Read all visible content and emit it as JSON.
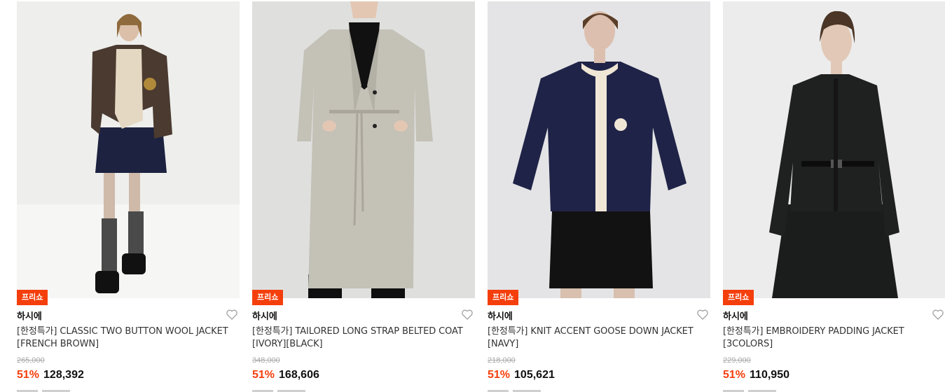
{
  "products": [
    {
      "badge": "프리쇼",
      "brand": "하시에",
      "title": "[한정특가] CLASSIC TWO BUTTON WOOL JACKET [FRENCH BROWN]",
      "original_price": "265,000",
      "discount": "51%",
      "price": "128,392",
      "image_icon": "model-brown-wool-jacket-photo"
    },
    {
      "badge": "프리쇼",
      "brand": "하시에",
      "title": "[한정특가] TAILORED LONG STRAP BELTED COAT [IVORY][BLACK]",
      "original_price": "348,000",
      "discount": "51%",
      "price": "168,606",
      "image_icon": "model-ivory-long-coat-photo"
    },
    {
      "badge": "프리쇼",
      "brand": "하시에",
      "title": "[한정특가] KNIT ACCENT GOOSE DOWN JACKET [NAVY]",
      "original_price": "218,000",
      "discount": "51%",
      "price": "105,621",
      "image_icon": "model-navy-quilted-jacket-photo"
    },
    {
      "badge": "프리쇼",
      "brand": "하시에",
      "title": "[한정특가] EMBROIDERY PADDING JACKET [3COLORS]",
      "original_price": "229,000",
      "discount": "51%",
      "price": "110,950",
      "image_icon": "model-black-padding-jacket-photo"
    }
  ],
  "colors": {
    "accent": "#f43f0d",
    "strike": "#aaaaaa",
    "text": "#111111"
  },
  "icons": {
    "like": "heart-outline-icon"
  }
}
